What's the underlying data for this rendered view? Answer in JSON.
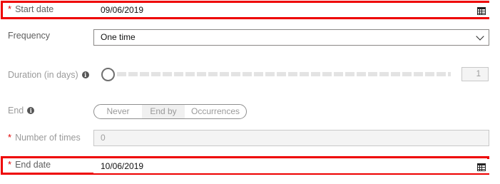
{
  "start_date": {
    "label": "Start date",
    "required_mark": "*",
    "value": "09/06/2019"
  },
  "frequency": {
    "label": "Frequency",
    "selected": "One time"
  },
  "duration": {
    "label": "Duration (in days)",
    "value": "1"
  },
  "end": {
    "label": "End",
    "options": [
      "Never",
      "End by",
      "Occurrences"
    ],
    "selected": "End by"
  },
  "number_of_times": {
    "label": "Number of times",
    "required_mark": "*",
    "value": "0"
  },
  "end_date": {
    "label": "End date",
    "required_mark": "*",
    "value": "10/06/2019"
  },
  "icons": {
    "info": "i",
    "calendar": "calendar-icon",
    "chevron": "chevron-down-icon"
  },
  "colors": {
    "highlight": "#ee0000",
    "required": "#e00000"
  }
}
